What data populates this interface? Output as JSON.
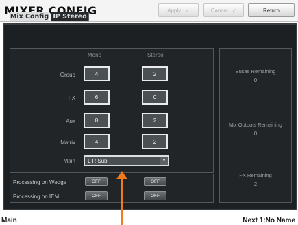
{
  "header": {
    "title": "MIXER CONFIG",
    "apply_label": "Apply",
    "cancel_label": "Cancel",
    "return_label": "Return"
  },
  "tabs": [
    {
      "label": "Mix Config",
      "active": true
    },
    {
      "label": "IP Stereo",
      "active": false
    }
  ],
  "columns": {
    "mono": "Mono",
    "stereo": "Stereo"
  },
  "rows": [
    {
      "label": "Group",
      "mono": "4",
      "stereo": "2"
    },
    {
      "label": "FX",
      "mono": "6",
      "stereo": "0"
    },
    {
      "label": "Aux",
      "mono": "8",
      "stereo": "2"
    },
    {
      "label": "Matrix",
      "mono": "4",
      "stereo": "2"
    }
  ],
  "main": {
    "label": "Main",
    "selected": "L R Sub"
  },
  "processing": [
    {
      "label": "Processing on Wedge",
      "mono": "OFF",
      "stereo": "OFF"
    },
    {
      "label": "Processing on IEM",
      "mono": "OFF",
      "stereo": "OFF"
    }
  ],
  "info": [
    {
      "label": "Buses Remaining",
      "value": "0"
    },
    {
      "label": "Mix Outputs Remaining",
      "value": "0"
    },
    {
      "label": "FX Remaining",
      "value": "2"
    }
  ],
  "footer": {
    "left": "Main",
    "right": "Next 1:No Name"
  },
  "colors": {
    "accent": "#f07a1e",
    "panel": "#1d2022",
    "box": "#4b5053"
  },
  "icons": {
    "apply": "check-icon",
    "cancel": "check-icon",
    "dropdown": "chevron-down-icon"
  }
}
